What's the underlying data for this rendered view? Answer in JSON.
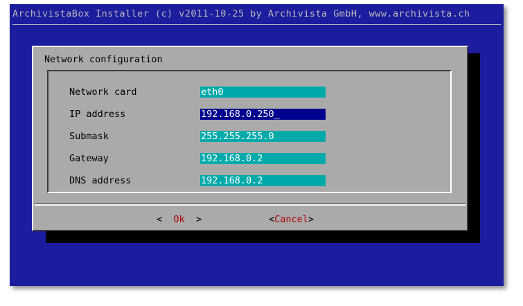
{
  "header": {
    "title": "ArchivistaBox Installer (c) v2011-10-25 by Archivista GmbH, www.archivista.ch"
  },
  "dialog": {
    "title": "Network configuration",
    "fields": [
      {
        "label": "Network card",
        "value": "eth0"
      },
      {
        "label": "IP address",
        "value": "192.168.0.250",
        "focused": true
      },
      {
        "label": "Submask",
        "value": "255.255.255.0"
      },
      {
        "label": "Gateway",
        "value": "192.168.0.2"
      },
      {
        "label": "DNS address",
        "value": "192.168.0.2"
      }
    ],
    "buttons": {
      "ok": {
        "left": "<",
        "hot": "O",
        "rest": "k",
        "right": ">"
      },
      "cancel": {
        "left": "<",
        "hot": "C",
        "rest": "ancel",
        "right": ">"
      }
    }
  },
  "colors": {
    "screen_bg": "#1c1c9e",
    "dialog_bg": "#aaaaaa",
    "field_bg": "#00aaaa",
    "field_focus_bg": "#00008e",
    "hotkey": "#b00000"
  }
}
